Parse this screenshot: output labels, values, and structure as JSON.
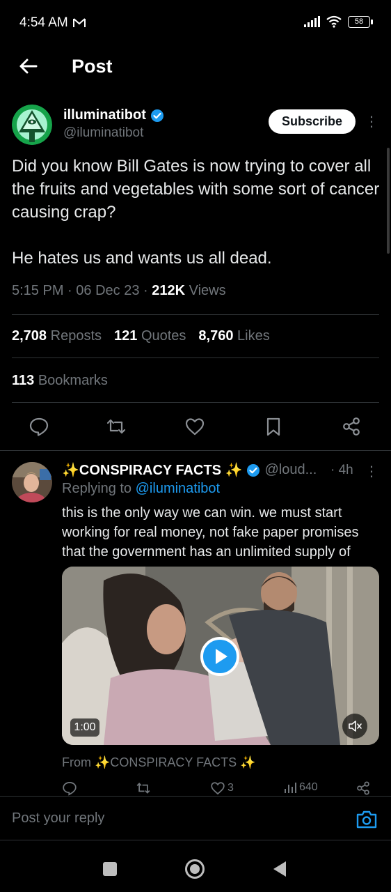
{
  "status_bar": {
    "time": "4:54 AM",
    "battery": "58"
  },
  "header": {
    "title": "Post"
  },
  "post": {
    "author_name": "illuminatibot",
    "author_handle": "@iluminatibot",
    "subscribe_label": "Subscribe",
    "text_p1": "Did you know Bill Gates is now trying to cover all the fruits and vegetables with some sort of cancer causing crap?",
    "text_p2": "He hates us and wants us all dead.",
    "time": "5:15 PM",
    "date": "06 Dec 23",
    "views_count": "212K",
    "views_label": "Views",
    "reposts_count": "2,708",
    "reposts_label": "Reposts",
    "quotes_count": "121",
    "quotes_label": "Quotes",
    "likes_count": "8,760",
    "likes_label": "Likes",
    "bookmarks_count": "113",
    "bookmarks_label": "Bookmarks"
  },
  "reply": {
    "author_name": "✨CONSPIRACY FACTS ✨",
    "author_handle": "@loud...",
    "time": "· 4h",
    "replying_prefix": "Replying to ",
    "replying_handle": "@iluminatibot",
    "text": "this is the only way we can win. we must start working for real money, not fake paper promises that the government has an unlimited supply of",
    "video_duration": "1:00",
    "from_prefix": "From ",
    "from_source": "✨CONSPIRACY FACTS ✨",
    "likes": "3",
    "views": "640"
  },
  "composer": {
    "placeholder": "Post your reply"
  },
  "colors": {
    "accent": "#1d9bf0",
    "background": "#000000",
    "muted": "#71767b"
  }
}
